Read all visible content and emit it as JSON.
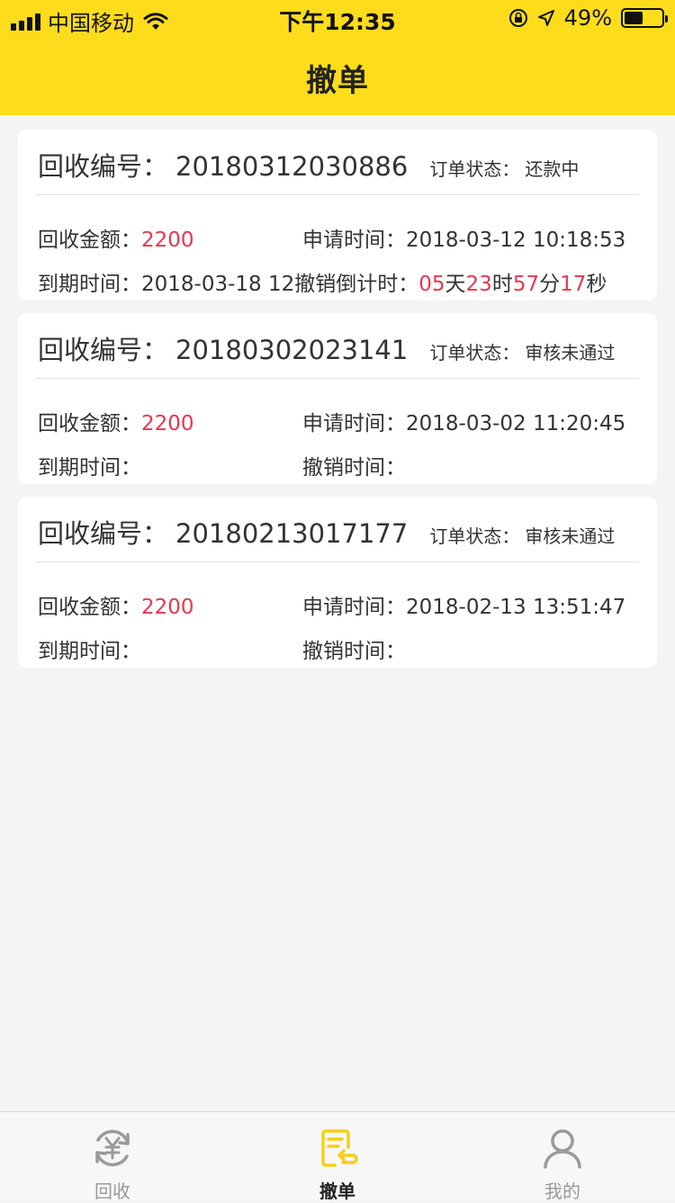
{
  "status_bar": {
    "carrier": "中国移动",
    "time": "下午12:35",
    "battery_text": "49%",
    "battery_level": 0.49
  },
  "header": {
    "title": "撤单"
  },
  "labels": {
    "order_no": "回收编号：",
    "order_status": "订单状态：",
    "amount": "回收金额：",
    "apply_time": "申请时间：",
    "due_time": "到期时间：",
    "cancel_countdown": "撤销倒计时：",
    "cancel_time": "撤销时间："
  },
  "orders": [
    {
      "id": "20180312030886",
      "status": "还款中",
      "amount": "2200",
      "apply_time": "2018-03-12 10:18:53",
      "due_time": "2018-03-18 12",
      "countdown": {
        "days": "05",
        "hours": "23",
        "minutes": "57",
        "seconds": "17",
        "day_unit": "天",
        "hour_unit": "时",
        "minute_unit": "分",
        "second_unit": "秒"
      }
    },
    {
      "id": "20180302023141",
      "status": "审核未通过",
      "amount": "2200",
      "apply_time": "2018-03-02 11:20:45",
      "due_time": "",
      "cancel_time": ""
    },
    {
      "id": "20180213017177",
      "status": "审核未通过",
      "amount": "2200",
      "apply_time": "2018-02-13 13:51:47",
      "due_time": "",
      "cancel_time": ""
    }
  ],
  "tabbar": {
    "items": [
      {
        "label": "回收",
        "icon": "yen-refresh-icon"
      },
      {
        "label": "撤单",
        "icon": "cancel-order-icon"
      },
      {
        "label": "我的",
        "icon": "user-icon"
      }
    ]
  },
  "colors": {
    "brand": "#fddc1c",
    "highlight": "#e8374f",
    "background": "#f4f4f4"
  }
}
